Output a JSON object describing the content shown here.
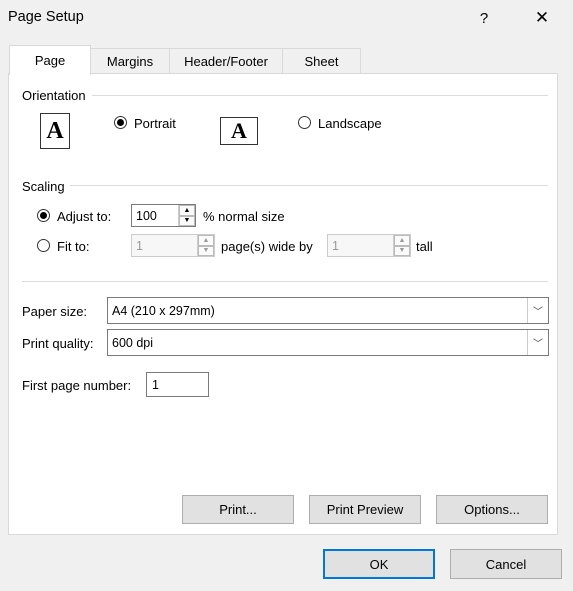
{
  "window": {
    "title": "Page Setup",
    "help_label": "?",
    "close_label": "✕"
  },
  "tabs": [
    {
      "label": "Page"
    },
    {
      "label": "Margins"
    },
    {
      "label": "Header/Footer"
    },
    {
      "label": "Sheet"
    }
  ],
  "orientation": {
    "section_label": "Orientation",
    "portrait_label": "Portrait",
    "landscape_label": "Landscape",
    "icon_glyph": "A",
    "selected": "Portrait"
  },
  "scaling": {
    "section_label": "Scaling",
    "adjust_label": "Adjust to:",
    "adjust_value": "100",
    "adjust_suffix": "% normal size",
    "fit_label": "Fit to:",
    "fit_wide_value": "1",
    "fit_wide_suffix": "page(s) wide by",
    "fit_tall_value": "1",
    "fit_tall_suffix": "tall",
    "selected": "Adjust to:"
  },
  "paper_size": {
    "label": "Paper size:",
    "value": "A4 (210 x 297mm)"
  },
  "print_quality": {
    "label": "Print quality:",
    "value": "600 dpi"
  },
  "first_page": {
    "label": "First page number:",
    "value": "1"
  },
  "action_buttons": {
    "print": "Print...",
    "print_preview": "Print Preview",
    "options": "Options..."
  },
  "footer_buttons": {
    "ok": "OK",
    "cancel": "Cancel"
  },
  "colors": {
    "accent": "#0078d7",
    "panel_bg": "#ffffff",
    "window_bg": "#f0f0f0"
  }
}
